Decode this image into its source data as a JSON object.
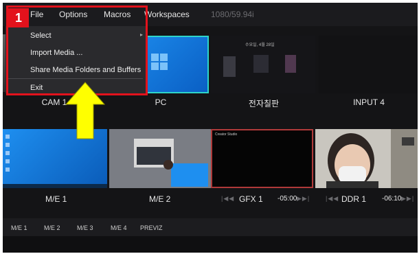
{
  "menubar": {
    "items": [
      "File",
      "Options",
      "Macros",
      "Workspaces"
    ],
    "resolution": "1080/59.94i"
  },
  "file_menu": {
    "items": [
      "Select",
      "Import Media ...",
      "Share Media Folders and Buffers",
      "Exit"
    ]
  },
  "annotation": {
    "step_number": "1",
    "highlight_color": "#e3121c",
    "arrow_color": "#ffff00"
  },
  "sources_row1": [
    {
      "label": "CAM 1"
    },
    {
      "label": "PC"
    },
    {
      "label": "전자칠판",
      "inner_title": "수요일, 4월 28일"
    },
    {
      "label": "INPUT 4"
    }
  ],
  "sources_row2": [
    {
      "label": "M/E 1"
    },
    {
      "label": "M/E 2"
    },
    {
      "label": "GFX 1",
      "timecode": "-05:00",
      "inner_title": "Creator Studio"
    },
    {
      "label": "DDR 1",
      "timecode": "-06:10"
    }
  ],
  "transport_glyphs": [
    "|◀◀",
    "▶▶|"
  ],
  "bottom_tabs": [
    "M/E 1",
    "M/E 2",
    "M/E 3",
    "M/E 4",
    "PREVIZ"
  ],
  "colors": {
    "background": "#141416",
    "selected_border": "#2fd5c8",
    "gfx_border": "#b03a3a",
    "windows_blue": "#1e8ff0"
  }
}
